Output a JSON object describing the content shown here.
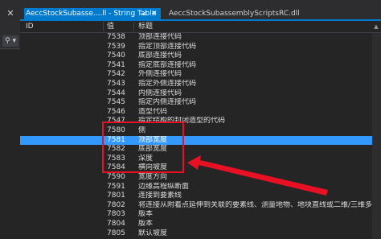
{
  "tabs": {
    "active_label": "AeccStockSubasse....ll - String Table",
    "inactive_label": "AeccStockSubassemblyScriptsRC.dll",
    "pin_glyph": "⊿",
    "close_glyph": "✕"
  },
  "header": {
    "id": "ID",
    "value": "值",
    "caption": "标题"
  },
  "rows": [
    {
      "value": "7538",
      "caption": "顶部连接代码"
    },
    {
      "value": "7539",
      "caption": "指定顶部连接代码"
    },
    {
      "value": "7540",
      "caption": "底部连接代码"
    },
    {
      "value": "7541",
      "caption": "指定底部连接代码"
    },
    {
      "value": "7542",
      "caption": "外侧连接代码"
    },
    {
      "value": "7543",
      "caption": "指定外侧连接代码"
    },
    {
      "value": "7544",
      "caption": "内侧连接代码"
    },
    {
      "value": "7545",
      "caption": "指定内侧连接代码"
    },
    {
      "value": "7546",
      "caption": "造型代码"
    },
    {
      "value": "7547",
      "caption": "指定结构的封闭造型的代码"
    },
    {
      "value": "7580",
      "caption": "侧"
    },
    {
      "value": "7581",
      "caption": "顶部宽度"
    },
    {
      "value": "7582",
      "caption": "底部宽度"
    },
    {
      "value": "7583",
      "caption": "深度"
    },
    {
      "value": "7584",
      "caption": "横向坡度"
    },
    {
      "value": "7590",
      "caption": "宽度方向"
    },
    {
      "value": "7591",
      "caption": "边缘高程纵断面"
    },
    {
      "value": "7801",
      "caption": "连接到要素线"
    },
    {
      "value": "7802",
      "caption": "将连接从附着点延伸到关联的要素线、测量地物、地块直线或二维/三维多段线的…"
    },
    {
      "value": "7803",
      "caption": "版本"
    },
    {
      "value": "7804",
      "caption": "版本"
    },
    {
      "value": "7805",
      "caption": "默认坡度"
    }
  ],
  "selected_index": 11,
  "colors": {
    "selection": "#3399ff",
    "annotation": "#e81123",
    "tab_active": "#007acc"
  },
  "icons": {
    "left_rail_close": "✕",
    "left_rail_search": "⚲ ▾",
    "scroll_up": "▲"
  }
}
